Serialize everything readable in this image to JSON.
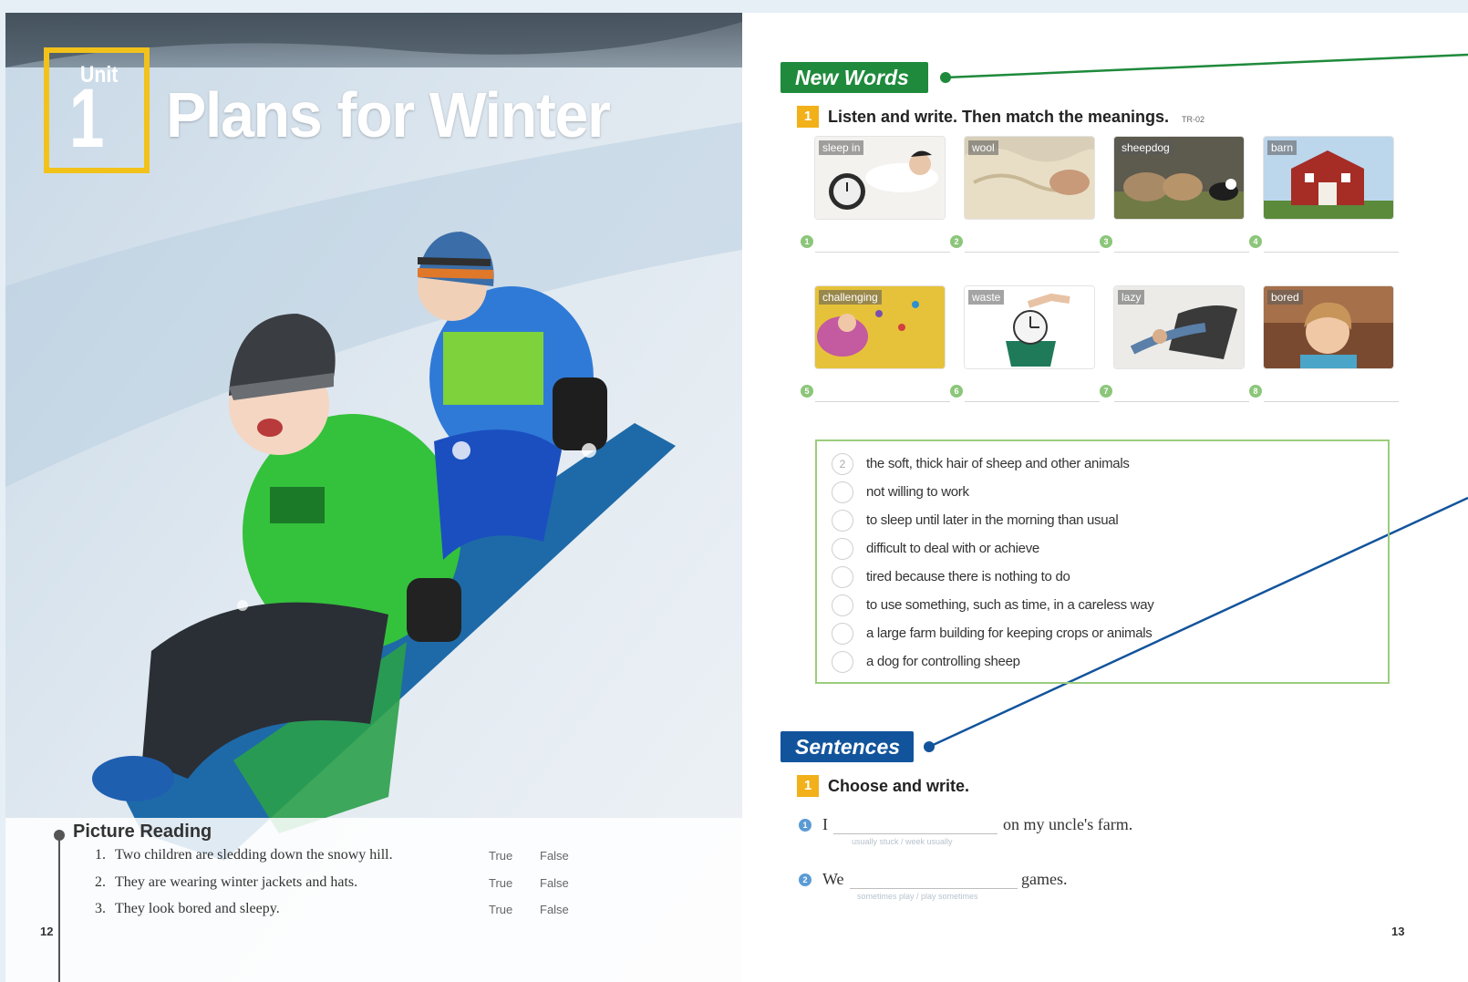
{
  "left_page": {
    "unit_label": "Unit",
    "unit_number": "1",
    "title": "Plans for Winter",
    "picture_reading": {
      "title": "Picture Reading",
      "items": [
        {
          "num": "1.",
          "text": "Two children are sledding down the snowy hill.",
          "true_label": "True",
          "false_label": "False"
        },
        {
          "num": "2.",
          "text": "They are wearing winter jackets and hats.",
          "true_label": "True",
          "false_label": "False"
        },
        {
          "num": "3.",
          "text": "They look bored and sleepy.",
          "true_label": "True",
          "false_label": "False"
        }
      ]
    },
    "page_number": "12"
  },
  "right_page": {
    "new_words": {
      "heading": "New Words",
      "exercise_number": "1",
      "instruction": "Listen and write. Then match the meanings.",
      "track": "TR-02",
      "cards": [
        {
          "label": "sleep in",
          "answer_num": "1"
        },
        {
          "label": "wool",
          "answer_num": "2"
        },
        {
          "label": "sheepdog",
          "answer_num": "3"
        },
        {
          "label": "barn",
          "answer_num": "4"
        },
        {
          "label": "challenging",
          "answer_num": "5"
        },
        {
          "label": "waste",
          "answer_num": "6"
        },
        {
          "label": "lazy",
          "answer_num": "7"
        },
        {
          "label": "bored",
          "answer_num": "8"
        }
      ],
      "meanings": [
        {
          "answer": "2",
          "text": "the soft, thick hair of sheep and other animals"
        },
        {
          "answer": "",
          "text": "not willing to work"
        },
        {
          "answer": "",
          "text": "to sleep until later in the morning than usual"
        },
        {
          "answer": "",
          "text": "difficult to deal with or achieve"
        },
        {
          "answer": "",
          "text": "tired because there is nothing to do"
        },
        {
          "answer": "",
          "text": "to use something, such as time, in a careless way"
        },
        {
          "answer": "",
          "text": "a large farm building for keeping crops or animals"
        },
        {
          "answer": "",
          "text": "a dog for controlling sheep"
        }
      ]
    },
    "sentences": {
      "heading": "Sentences",
      "exercise_number": "1",
      "instruction": "Choose and write.",
      "items": [
        {
          "num": "1",
          "before": "I",
          "after": "on my uncle's farm.",
          "hint": "usually stuck / week usually"
        },
        {
          "num": "2",
          "before": "We",
          "after": "games.",
          "hint": "sometimes play / play sometimes"
        }
      ]
    },
    "page_number": "13"
  },
  "colors": {
    "new_words_green": "#1f8a3c",
    "sentences_blue": "#12549c",
    "unit_yellow": "#f2c21a",
    "exercise_orange": "#f2b01a"
  }
}
